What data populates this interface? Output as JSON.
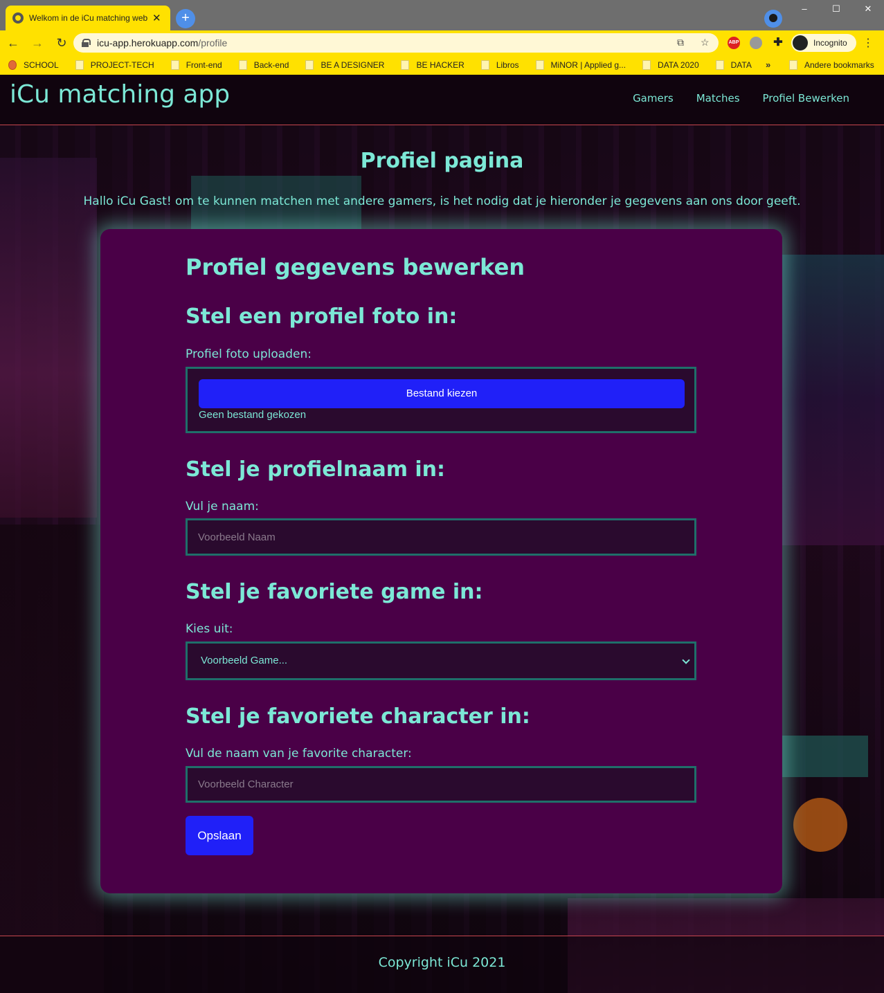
{
  "browser": {
    "tab_title": "Welkom in de iCu matching web",
    "url_host": "icu-app.herokuapp.com",
    "url_path": "/profile",
    "profile_label": "Incognito",
    "window_controls": [
      "–",
      "☐",
      "✕"
    ],
    "bookmarks": [
      {
        "label": "SCHOOL",
        "icon": "school-icon"
      },
      {
        "label": "PROJECT-TECH",
        "icon": "folder-icon"
      },
      {
        "label": "Front-end",
        "icon": "folder-icon"
      },
      {
        "label": "Back-end",
        "icon": "folder-icon"
      },
      {
        "label": "BE A DESIGNER",
        "icon": "folder-icon"
      },
      {
        "label": "BE HACKER",
        "icon": "folder-icon"
      },
      {
        "label": "Libros",
        "icon": "folder-icon"
      },
      {
        "label": "MiNOR | Applied g...",
        "icon": "folder-icon"
      },
      {
        "label": "DATA 2020",
        "icon": "folder-icon"
      },
      {
        "label": "DATA",
        "icon": "folder-icon"
      }
    ],
    "bookmarks_more": "»",
    "other_bookmarks": "Andere bookmarks"
  },
  "site": {
    "title": "iCu matching app",
    "nav": [
      "Gamers",
      "Matches",
      "Profiel Bewerken"
    ],
    "heading": "Profiel pagina",
    "intro": "Hallo iCu Gast! om te kunnen matchen met andere gamers, is het nodig dat je hieronder je gegevens aan ons door geeft.",
    "footer": "Copyright iCu 2021"
  },
  "form": {
    "title": "Profiel gegevens bewerken",
    "photo": {
      "section": "Stel een profiel foto in:",
      "label": "Profiel foto uploaden:",
      "button": "Bestand kiezen",
      "status": "Geen bestand gekozen"
    },
    "name": {
      "section": "Stel je profielnaam in:",
      "label": "Vul je naam:",
      "placeholder": "Voorbeeld Naam",
      "value": ""
    },
    "game": {
      "section": "Stel je favoriete game in:",
      "label": "Kies uit:",
      "selected": "Voorbeeld Game..."
    },
    "character": {
      "section": "Stel je favoriete character in:",
      "label": "Vul de naam van je favorite character:",
      "placeholder": "Voorbeeld Character",
      "value": ""
    },
    "save_label": "Opslaan"
  },
  "colors": {
    "accent_text": "#7ce8d6",
    "card_bg": "#4a0047",
    "button_bg": "#2020f8",
    "browser_theme": "#ffe100",
    "divider": "#c8464e"
  }
}
